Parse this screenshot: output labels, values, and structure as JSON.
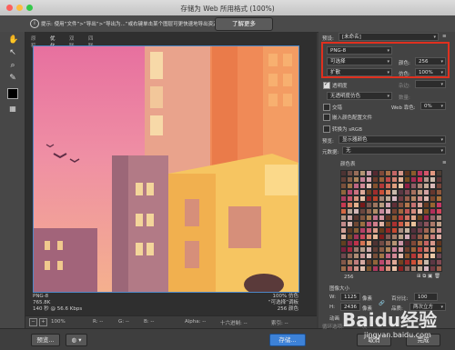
{
  "window": {
    "title": "存储为 Web 所用格式 (100%)"
  },
  "infobar": {
    "text": "提示: 使用“文件”>“导出”>“导出为...”或右键单击某个图层可更快速地导出资源",
    "learn_more": "了解更多"
  },
  "tabs": [
    "原稿",
    "优化",
    "双联",
    "四联"
  ],
  "canvas_info": {
    "format": "PNG-8",
    "size": "765.8K",
    "time": "140 秒 @ 56.6 Kbps",
    "quality": "100% 仿色",
    "palette": "“可选择”调板",
    "colors": "256 颜色"
  },
  "statusbar": {
    "zoom": "100%",
    "r": "R: --",
    "g": "G: --",
    "b": "B: --",
    "alpha": "Alpha: --",
    "hex": "十六进制: --",
    "index": "索引: --"
  },
  "bottom": {
    "preview": "预览...",
    "save": "存储...",
    "cancel": "取消",
    "done": "完成"
  },
  "panel": {
    "preset_label": "预设:",
    "preset_value": "[未命名]",
    "format": "PNG-8",
    "reduction": "可选择",
    "colors_label": "颜色:",
    "colors_value": "256",
    "dither_algo": "扩散",
    "dither_label": "仿色:",
    "dither_value": "100%",
    "transparency": "透明度",
    "matte_label": "杂边:",
    "transparency_dither": "无透明度仿色",
    "amount_label": "数量:",
    "interlaced": "交错",
    "web_snap_label": "Web 靠色:",
    "web_snap_value": "0%",
    "embed_profile": "嵌入颜色配置文件",
    "convert_srgb": "转换为 sRGB",
    "preview_label": "预览:",
    "preview_value": "显示器颜色",
    "metadata_label": "元数据:",
    "metadata_value": "无",
    "color_table": "颜色表",
    "ct_count": "256",
    "image_size": "图像大小",
    "w_label": "W:",
    "w_value": "1125",
    "h_label": "H:",
    "h_value": "2436",
    "px": "像素",
    "percent_label": "百分比:",
    "percent_value": "100",
    "quality_label": "品质:",
    "quality_value": "两次立方",
    "animation": "动画",
    "loop_label": "循环选项:",
    "loop_value": "一次"
  },
  "watermark": {
    "brand": "Baidu经验",
    "url": "jingyan.baidu.com"
  }
}
